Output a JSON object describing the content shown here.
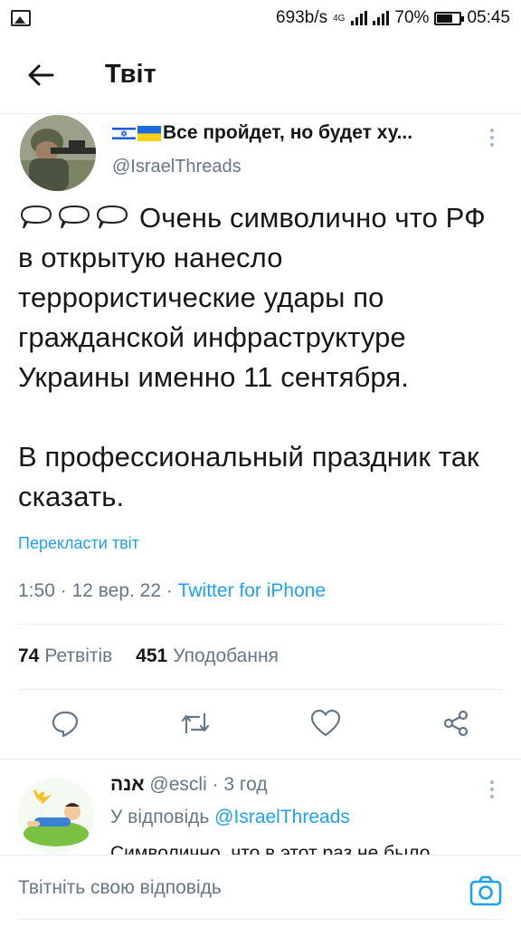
{
  "status_bar": {
    "speed": "693b/s",
    "network": "4G",
    "battery_percent": "70%",
    "battery_level": 0.7,
    "time": "05:45"
  },
  "header": {
    "back_icon": "arrow-left-icon",
    "title": "Твіт"
  },
  "tweet": {
    "author_name": "Все пройдет, но будет ху...",
    "author_flags": [
      "israel-flag-icon",
      "ukraine-flag-icon"
    ],
    "handle": "@IsraelThreads",
    "body_line1": "Очень символично что РФ в открытую нанесло террористические удары по гражданской инфраструктуре Украины именно 11 сентября.",
    "body_line2": "В профессиональный праздник так сказать.",
    "translate_label": "Перекласти твіт",
    "time": "1:50 · 12 вер. 22 · ",
    "source": "Twitter for iPhone",
    "retweets_count": "74",
    "retweets_label": "Ретвітів",
    "likes_count": "451",
    "likes_label": "Уподобання",
    "actions": [
      "reply-icon",
      "retweet-icon",
      "like-icon",
      "share-icon"
    ]
  },
  "reply": {
    "name": "אנה",
    "handle": "@escli",
    "time": "· 3 год",
    "reply_prefix": "У відповідь",
    "reply_mention": "@IsraelThreads",
    "text": "Символично, что в этот раз не было"
  },
  "composer": {
    "placeholder": "Твітніть свою відповідь",
    "camera_icon": "camera-icon"
  },
  "colors": {
    "accent": "#1da1f2",
    "muted": "#657786",
    "text": "#14171a",
    "divider": "#e6ecf0"
  }
}
